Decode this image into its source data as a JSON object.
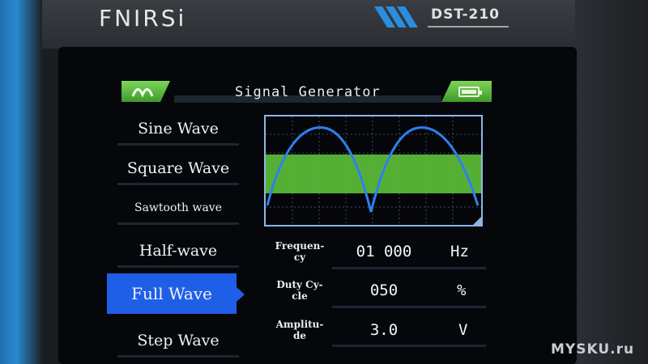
{
  "device": {
    "brand": "FNIRSi",
    "model": "DST-210"
  },
  "header": {
    "title": "Signal Generator",
    "wave_icon": "wave-icon",
    "battery_icon": "battery-icon"
  },
  "menu": {
    "items": [
      {
        "label": "Sine Wave"
      },
      {
        "label": "Square Wave"
      },
      {
        "label": "Sawtooth wave"
      },
      {
        "label": "Half-wave"
      },
      {
        "label": "Full Wave"
      },
      {
        "label": "Step Wave"
      }
    ],
    "selected": "Full Wave"
  },
  "preview": {
    "waveform": "full-wave rectified sine",
    "colors": {
      "wave": "#2e7ff0",
      "band": "#5fc23a",
      "border": "#8eb5e6"
    }
  },
  "params": {
    "frequency": {
      "label_line1": "Frequen-",
      "label_line2": "cy",
      "value": "01 000",
      "unit": "Hz"
    },
    "duty_cycle": {
      "label_line1": "Duty Cy-",
      "label_line2": "cle",
      "value": "050",
      "unit": "%"
    },
    "amplitude": {
      "label_line1": "Amplitu-",
      "label_line2": "de",
      "value": "3.0",
      "unit": "V"
    }
  },
  "watermark": "MYSKU.ru",
  "colors": {
    "accent": "#1f5fe8",
    "header_green": "#5fc23a",
    "screen_bg": "#06070b"
  }
}
